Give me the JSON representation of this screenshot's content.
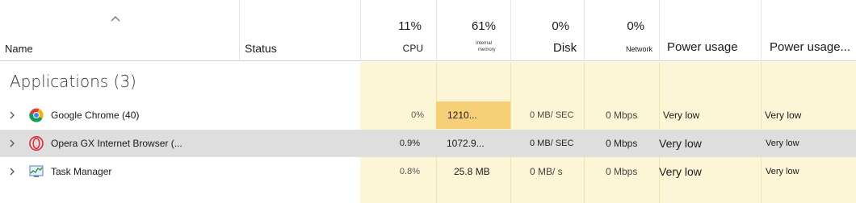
{
  "header": {
    "name_label": "Name",
    "status_label": "Status",
    "cpu_pct": "11%",
    "cpu_label": "CPU",
    "memory_pct": "61%",
    "memory_label_line1": "Internal",
    "memory_label_line2": "memory",
    "disk_pct": "0%",
    "disk_label": "Disk",
    "network_pct": "0%",
    "network_label": "Network",
    "power_label": "Power usage",
    "power_trend_label": "Power usage..."
  },
  "group": {
    "label": "Applications (3)"
  },
  "rows": [
    {
      "name": "Google Chrome (40)",
      "cpu": "0%",
      "memory": "1210...",
      "disk": "0 MB/ SEC",
      "network": "0 Mbps",
      "power": "Very low",
      "power_trend": "Very low",
      "icon": "chrome-icon"
    },
    {
      "name": "Opera GX Internet Browser (...",
      "cpu": "0.9%",
      "memory": "1072.9...",
      "disk": "0 MB/ SEC",
      "network": "0 Mbps",
      "power": "Very low",
      "power_trend": "Very low",
      "icon": "opera-icon"
    },
    {
      "name": "Task Manager",
      "cpu": "0.8%",
      "memory": "25.8 MB",
      "disk": "0 MB/ s",
      "network": "0 Mbps",
      "power": "Very low",
      "power_trend": "Very low",
      "icon": "task-manager-icon"
    }
  ],
  "colors": {
    "heat_light": "#fdf6d6",
    "heat_strong": "#f7cf77",
    "selected_row": "#dedede"
  }
}
